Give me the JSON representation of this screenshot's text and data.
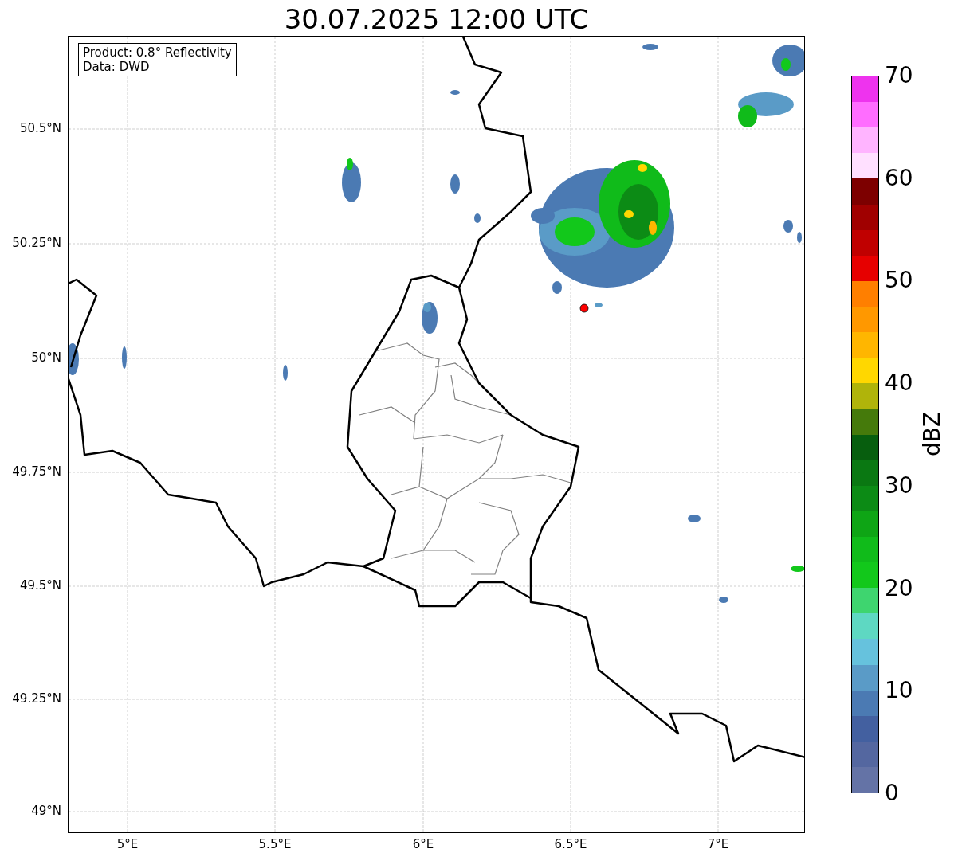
{
  "title": "30.07.2025 12:00 UTC",
  "info_box": {
    "lines": [
      "Product: 0.8° Reflectivity",
      "Data: DWD"
    ]
  },
  "map": {
    "yticks": [
      "50.5°N",
      "50.25°N",
      "50°N",
      "49.75°N",
      "49.5°N",
      "49.25°N",
      "49°N"
    ],
    "xticks": [
      "5°E",
      "5.5°E",
      "6°E",
      "6.5°E",
      "7°E"
    ]
  },
  "colorbar": {
    "label": "dBZ",
    "ticks": [
      "70",
      "60",
      "50",
      "40",
      "30",
      "20",
      "10",
      "0"
    ],
    "segments": [
      {
        "color": "#ee33ee"
      },
      {
        "color": "#ff6dff"
      },
      {
        "color": "#ffb4ff"
      },
      {
        "color": "#ffe0ff"
      },
      {
        "color": "#7d0000"
      },
      {
        "color": "#a00000"
      },
      {
        "color": "#c00000"
      },
      {
        "color": "#e60000"
      },
      {
        "color": "#ff7f00"
      },
      {
        "color": "#ff9800"
      },
      {
        "color": "#ffb600"
      },
      {
        "color": "#ffd700"
      },
      {
        "color": "#b0b40a"
      },
      {
        "color": "#457a0b"
      },
      {
        "color": "#075e0e"
      },
      {
        "color": "#0a7812"
      },
      {
        "color": "#0c8b15"
      },
      {
        "color": "#0ea515"
      },
      {
        "color": "#10bb1a"
      },
      {
        "color": "#12c81b"
      },
      {
        "color": "#3ed56f"
      },
      {
        "color": "#5ed8c2"
      },
      {
        "color": "#66c2dd"
      },
      {
        "color": "#5a9bc7"
      },
      {
        "color": "#4b7ab3"
      },
      {
        "color": "#4360a0"
      },
      {
        "color": "#5467a0"
      },
      {
        "color": "#6473a6"
      }
    ]
  }
}
